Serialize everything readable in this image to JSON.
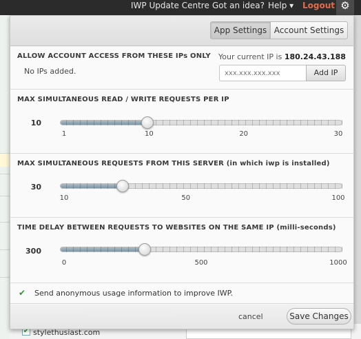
{
  "topbar": {
    "update_centre": "IWP Update Centre",
    "got_idea": "Got an idea?",
    "help": "Help ▾",
    "logout": "Logout",
    "settings_icon": "gear-icon"
  },
  "tabs": [
    {
      "label": "App Settings",
      "active": true
    },
    {
      "label": "Account Settings",
      "active": false
    }
  ],
  "ip_access": {
    "title": "ALLOW ACCOUNT ACCESS FROM THESE IPs ONLY",
    "empty_note": "No IPs added.",
    "current_ip_prefix": "Your current IP is",
    "current_ip": "180.24.43.188",
    "input_placeholder": "xxx.xxx.xxx.xxx",
    "add_button": "Add IP"
  },
  "sliders": [
    {
      "title": "MAX SIMULTANEOUS READ / WRITE REQUESTS PER IP",
      "value": "10",
      "fraction": 0.31,
      "labels": [
        {
          "text": "1",
          "pos": 0
        },
        {
          "text": "10",
          "pos": 0.31
        },
        {
          "text": "20",
          "pos": 0.655
        },
        {
          "text": "30",
          "pos": 1
        }
      ]
    },
    {
      "title": "MAX SIMULTANEOUS REQUESTS FROM THIS SERVER (in which iwp is installed)",
      "value": "30",
      "fraction": 0.222,
      "labels": [
        {
          "text": "10",
          "pos": 0
        },
        {
          "text": "50",
          "pos": 0.444
        },
        {
          "text": "100",
          "pos": 1
        }
      ]
    },
    {
      "title": "TIME DELAY BETWEEN REQUESTS TO WEBSITES ON THE SAME IP (milli-seconds)",
      "value": "300",
      "fraction": 0.3,
      "labels": [
        {
          "text": "0",
          "pos": 0
        },
        {
          "text": "500",
          "pos": 0.5
        },
        {
          "text": "1000",
          "pos": 1
        }
      ]
    }
  ],
  "usage": {
    "checked": true,
    "label": "Send anonymous usage information to improve IWP."
  },
  "footer": {
    "cancel": "cancel",
    "save": "Save Changes"
  },
  "background": {
    "domain": "stylethusiast.com"
  },
  "colors": {
    "topbar_bg": "#2b2b2b",
    "logout": "#e26b4a",
    "slider_fill": "#8aa1ad",
    "check_green": "#2a9a2a"
  }
}
